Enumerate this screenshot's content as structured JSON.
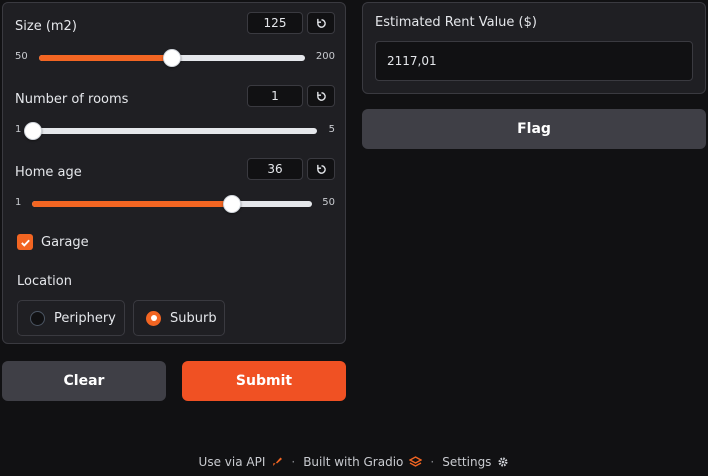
{
  "inputs": {
    "size": {
      "label": "Size (m2)",
      "value": "125",
      "min": "50",
      "max": "200",
      "fraction": 0.5
    },
    "rooms": {
      "label": "Number of rooms",
      "value": "1",
      "min": "1",
      "max": "5",
      "fraction": 0.0
    },
    "age": {
      "label": "Home age",
      "value": "36",
      "min": "1",
      "max": "50",
      "fraction": 0.714
    },
    "garage": {
      "label": "Garage",
      "checked": true
    },
    "location": {
      "label": "Location",
      "options": [
        "Periphery",
        "Suburb"
      ],
      "selected": "Suburb"
    }
  },
  "buttons": {
    "clear": "Clear",
    "submit": "Submit",
    "flag": "Flag"
  },
  "output": {
    "label": "Estimated Rent Value ($)",
    "value": "2117,01"
  },
  "footer": {
    "api": "Use via API",
    "built": "Built with Gradio",
    "settings": "Settings",
    "separator": "·"
  },
  "colors": {
    "accent": "#f26522",
    "submit": "#f05123",
    "secondary_button": "#3f3f46",
    "panel": "#1f1f23",
    "background": "#111113"
  }
}
